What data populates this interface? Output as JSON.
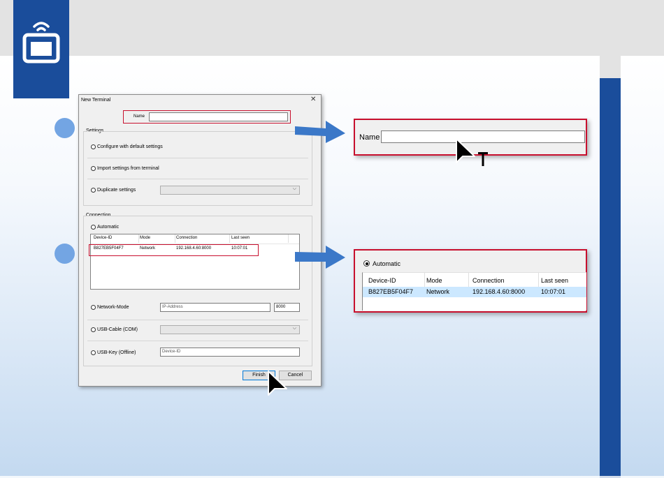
{
  "dialog": {
    "title": "New Terminal",
    "close_glyph": "✕",
    "name_label": "Name",
    "name_value": "",
    "settings": {
      "title": "Settings",
      "opt_default": "Configure with default settings",
      "opt_import": "Import settings from terminal",
      "opt_duplicate": "Duplicate settings"
    },
    "connection": {
      "title": "Connection",
      "opt_automatic": "Automatic",
      "table_headers": [
        "Device-ID",
        "Mode",
        "Connection",
        "Last seen"
      ],
      "rows": [
        {
          "device_id": "B827EB5F04F7",
          "mode": "Network",
          "connection": "192.168.4.60:8000",
          "last_seen": "10:07:01"
        }
      ],
      "opt_network": "Network-Mode",
      "ip_placeholder": "IP-Address",
      "port_value": "8000",
      "opt_usb_cable": "USB-Cable (COM)",
      "opt_usb_key": "USB-Key (Offline)",
      "device_id_placeholder": "Device-ID"
    },
    "finish_label": "Finish",
    "cancel_label": "Cancel"
  },
  "zoom_name": {
    "label": "Name",
    "value": ""
  },
  "zoom_automatic": {
    "label": "Automatic",
    "headers": [
      "Device-ID",
      "Mode",
      "Connection",
      "Last seen"
    ],
    "row": {
      "device_id": "B827EB5F04F7",
      "mode": "Network",
      "connection": "192.168.4.60:8000",
      "last_seen": "10:07:01"
    }
  },
  "colors": {
    "brand_blue": "#1a4d9b",
    "step_blue": "#73a5e3",
    "highlight_red": "#c8102e",
    "row_selected": "#cce8ff",
    "arrow_blue": "#3b78c8"
  },
  "icons": [
    "terminal-wifi-icon",
    "mouse-pointer-icon",
    "text-cursor-icon",
    "close-icon",
    "chevron-down-icon"
  ]
}
